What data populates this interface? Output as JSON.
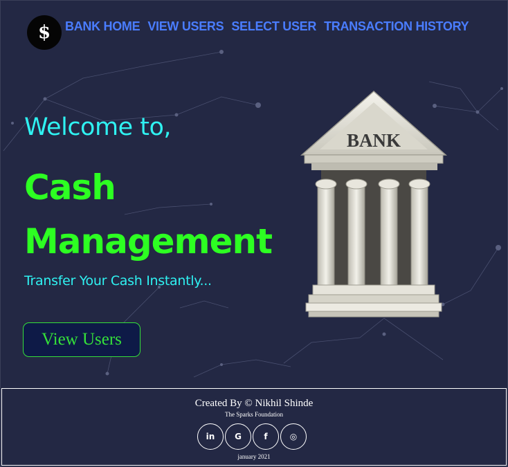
{
  "nav": {
    "logo_symbol": "$",
    "links": [
      "BANK HOME",
      "VIEW USERS",
      "SELECT USER",
      "TRANSACTION HISTORY"
    ]
  },
  "hero": {
    "welcome": "Welcome to,",
    "title_line1": "Cash",
    "title_line2": "Management",
    "tagline": "Transfer Your Cash Instantly...",
    "cta_label": "View Users",
    "bank_sign": "BANK"
  },
  "footer": {
    "credit": "Created By © Nikhil Shinde",
    "org": "The Sparks Foundation",
    "socials": [
      {
        "name": "linkedin-icon",
        "glyph": "in"
      },
      {
        "name": "google-icon",
        "glyph": "G"
      },
      {
        "name": "facebook-icon",
        "glyph": "f"
      },
      {
        "name": "instagram-icon",
        "glyph": "◎"
      }
    ],
    "date": "january 2021"
  },
  "colors": {
    "background": "#232844",
    "nav_link": "#4a7dff",
    "welcome": "#2ff2f2",
    "title": "#2dff22",
    "cta_border": "#35e03a"
  }
}
